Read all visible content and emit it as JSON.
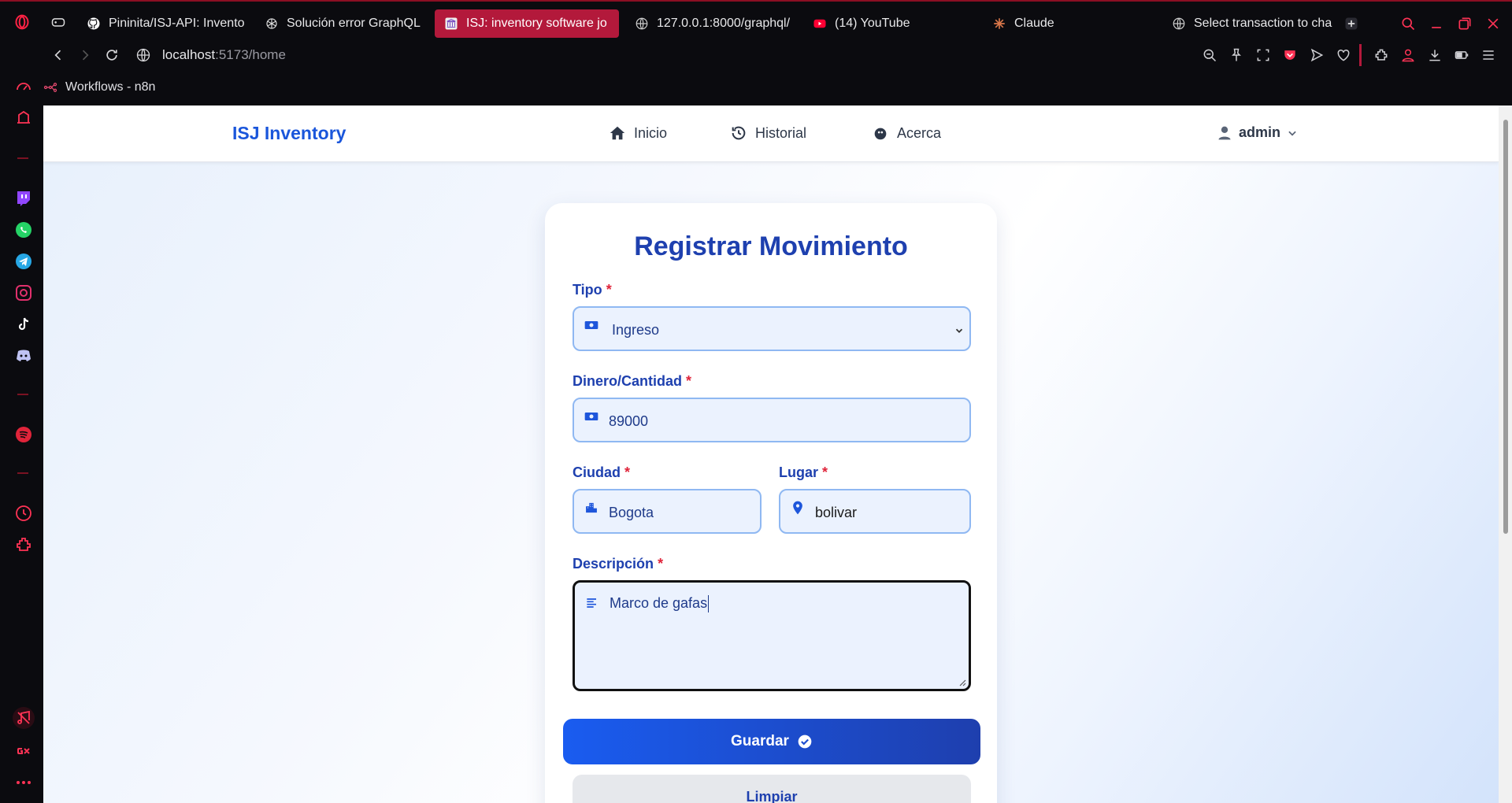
{
  "browser": {
    "tabs": [
      {
        "label": "Pininita/ISJ-API: Invento",
        "icon": "github-icon"
      },
      {
        "label": "Solución error GraphQL",
        "icon": "openai-icon"
      },
      {
        "label": "ISJ: inventory software jo",
        "icon": "bank-icon",
        "active": true
      },
      {
        "label": "127.0.0.1:8000/graphql/",
        "icon": "globe-icon"
      },
      {
        "label": "(14) YouTube",
        "icon": "youtube-icon"
      },
      {
        "label": "Claude",
        "icon": "claude-icon"
      },
      {
        "label": "Select transaction to cha",
        "icon": "globe-icon"
      }
    ],
    "url_host": "localhost",
    "url_path": ":5173/home",
    "bookmark": "Workflows - n8n",
    "accent": "#b3193b"
  },
  "app": {
    "brand": "ISJ Inventory",
    "nav": {
      "home": "Inicio",
      "history": "Historial",
      "about": "Acerca"
    },
    "user": "admin"
  },
  "form": {
    "title": "Registrar Movimiento",
    "required_mark": "*",
    "tipo": {
      "label": "Tipo",
      "value": "Ingreso"
    },
    "dinero": {
      "label": "Dinero/Cantidad",
      "value": "89000"
    },
    "ciudad": {
      "label": "Ciudad",
      "value": "Bogota"
    },
    "lugar": {
      "label": "Lugar",
      "value": "bolivar"
    },
    "descripcion": {
      "label": "Descripción",
      "value": "Marco de gafas"
    },
    "save_label": "Guardar",
    "clear_label": "Limpiar"
  }
}
